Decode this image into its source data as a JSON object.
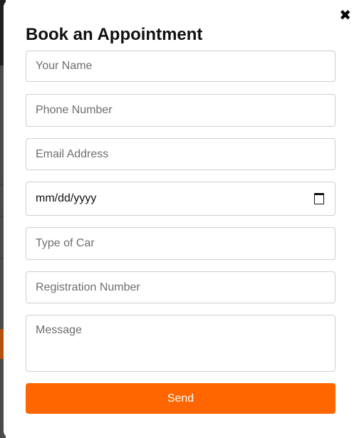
{
  "modal": {
    "title": "Book an Appointment",
    "close_icon": "close-icon",
    "fields": {
      "name_placeholder": "Your Name",
      "phone_placeholder": "Phone Number",
      "email_placeholder": "Email Address",
      "date_value": "mm/dd/yyyy",
      "car_placeholder": "Type of Car",
      "registration_placeholder": "Registration Number",
      "message_placeholder": "Message"
    },
    "send_label": "Send"
  },
  "colors": {
    "accent": "#ff6600",
    "border": "#cfcfcf"
  }
}
